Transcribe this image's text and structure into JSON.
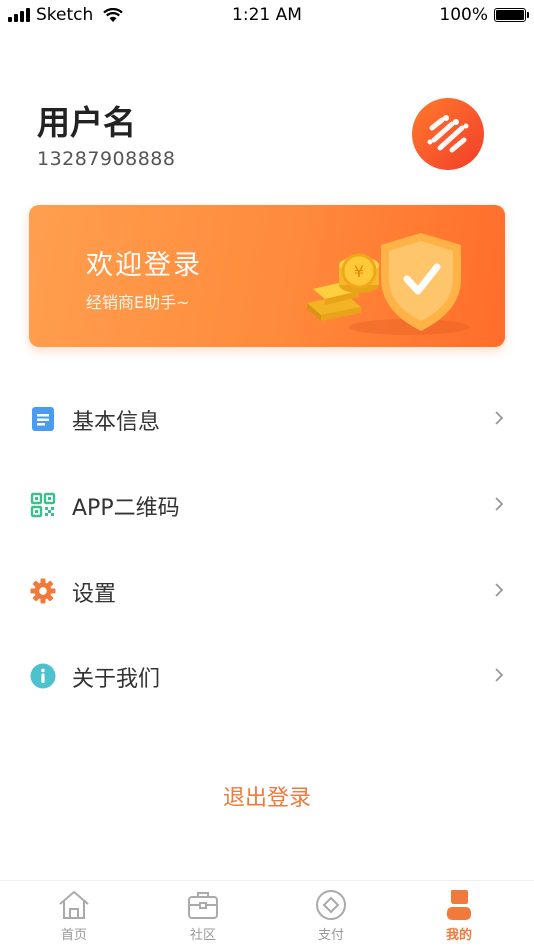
{
  "status_bar": {
    "carrier": "Sketch",
    "time": "1:21 AM",
    "battery": "100%"
  },
  "profile": {
    "username": "用户名",
    "phone": "13287908888"
  },
  "banner": {
    "title": "欢迎登录",
    "subtitle": "经销商E助手~"
  },
  "menu": [
    {
      "label": "基本信息",
      "icon": "document-icon"
    },
    {
      "label": "APP二维码",
      "icon": "qr-code-icon"
    },
    {
      "label": "设置",
      "icon": "gear-icon"
    },
    {
      "label": "关于我们",
      "icon": "info-icon"
    }
  ],
  "logout_label": "退出登录",
  "tabbar": [
    {
      "label": "首页",
      "icon": "home-icon"
    },
    {
      "label": "社区",
      "icon": "briefcase-icon"
    },
    {
      "label": "支付",
      "icon": "payment-icon"
    },
    {
      "label": "我的",
      "icon": "user-icon",
      "active": true
    }
  ],
  "colors": {
    "accent": "#f07a3c",
    "banner_start": "#ff9f4f",
    "banner_end": "#ff6d2a"
  }
}
